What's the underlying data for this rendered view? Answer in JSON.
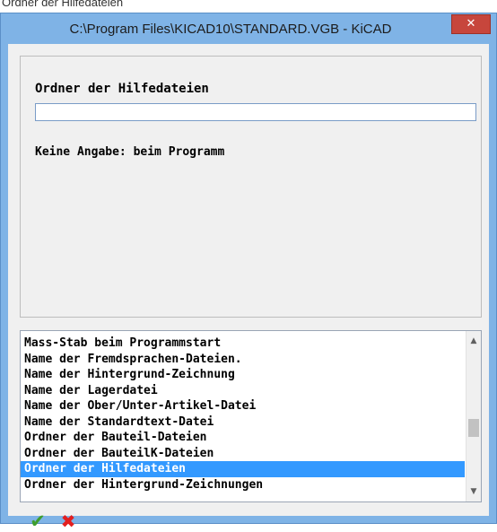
{
  "top_strip_text": "Ordner der Hilfedateien",
  "window": {
    "title": "C:\\Program Files\\KICAD10\\STANDARD.VGB - KiCAD",
    "close_glyph": "✕"
  },
  "setting": {
    "label": "Ordner der Hilfedateien",
    "value": "",
    "note": "Keine Angabe: beim Programm"
  },
  "list": {
    "items": [
      "Mass-Stab beim Programmstart",
      "Name der Fremdsprachen-Dateien.",
      "Name der Hintergrund-Zeichnung",
      "Name der Lagerdatei",
      "Name der Ober/Unter-Artikel-Datei",
      "Name der Standardtext-Datei",
      "Ordner der Bauteil-Dateien",
      "Ordner der BauteilK-Dateien",
      "Ordner der Hilfedateien",
      "Ordner der Hintergrund-Zeichnungen"
    ],
    "selected_index": 8,
    "scroll_up_glyph": "▲",
    "scroll_down_glyph": "▼"
  },
  "buttons": {
    "ok_glyph": "✔",
    "cancel_glyph": "✖"
  },
  "colors": {
    "titlebar": "#7fb3e6",
    "selection": "#3399ff",
    "ok": "#3e9e2e",
    "cancel": "#e31e1e"
  }
}
